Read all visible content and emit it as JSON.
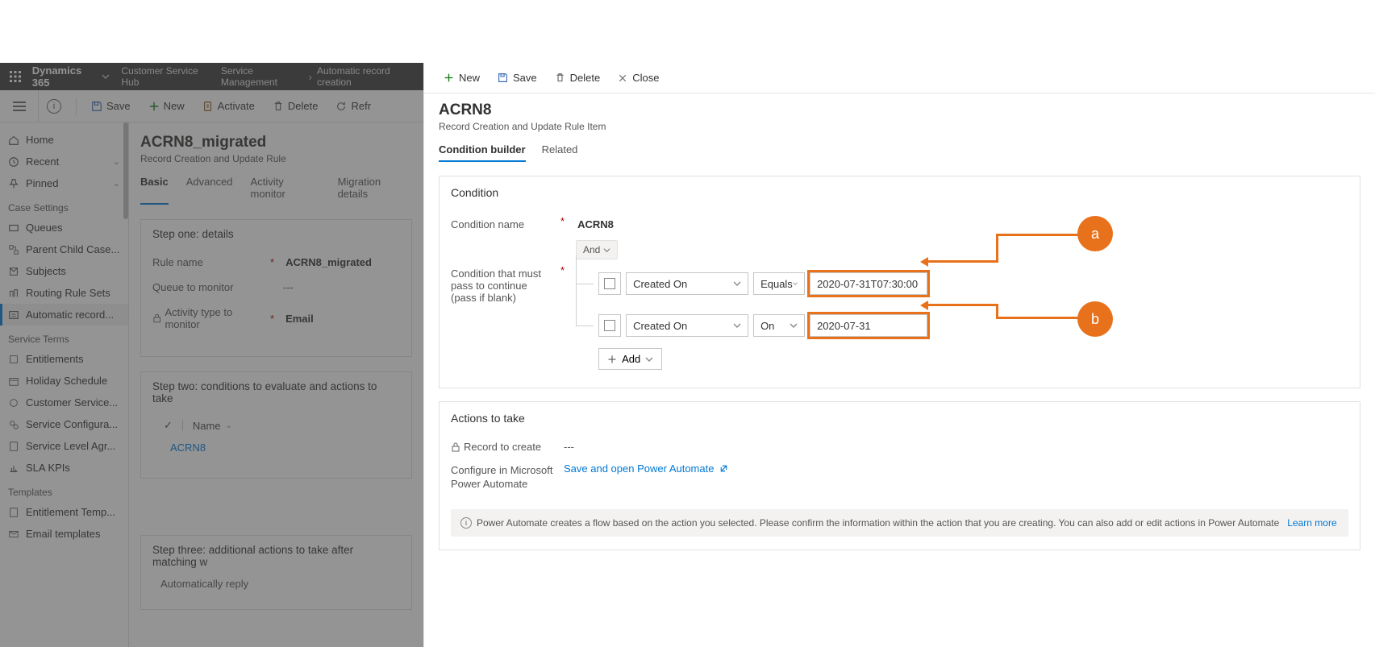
{
  "top_nav": {
    "brand": "Dynamics 365",
    "app_name": "Customer Service Hub",
    "breadcrumb": [
      "Service Management",
      "Automatic record creation"
    ]
  },
  "back_cmd": {
    "save": "Save",
    "new": "New",
    "activate": "Activate",
    "delete": "Delete",
    "refresh": "Refr"
  },
  "sidebar": {
    "home": "Home",
    "recent": "Recent",
    "pinned": "Pinned",
    "group_case": "Case Settings",
    "queues": "Queues",
    "parent_child": "Parent Child Case...",
    "subjects": "Subjects",
    "routing": "Routing Rule Sets",
    "automatic": "Automatic record...",
    "group_service": "Service Terms",
    "entitlements": "Entitlements",
    "holiday": "Holiday Schedule",
    "customer_service": "Customer Service...",
    "service_config": "Service Configura...",
    "sla_agr": "Service Level Agr...",
    "sla_kpis": "SLA KPIs",
    "group_templates": "Templates",
    "entitlement_temp": "Entitlement Temp...",
    "email_templates": "Email templates"
  },
  "back_record": {
    "title": "ACRN8_migrated",
    "subtitle": "Record Creation and Update Rule",
    "tabs": [
      "Basic",
      "Advanced",
      "Activity monitor",
      "Migration details"
    ],
    "step1_title": "Step one: details",
    "rule_name_label": "Rule name",
    "rule_name_value": "ACRN8_migrated",
    "queue_label": "Queue to monitor",
    "queue_value": "---",
    "activity_type_label": "Activity type to monitor",
    "activity_type_value": "Email",
    "step2_title": "Step two: conditions to evaluate and actions to take",
    "col_name": "Name",
    "list_item": "ACRN8",
    "step3_title": "Step three: additional actions to take after matching w",
    "auto_reply": "Automatically reply"
  },
  "panel_cmd": {
    "new": "New",
    "save": "Save",
    "delete": "Delete",
    "close": "Close"
  },
  "panel": {
    "title": "ACRN8",
    "subtitle": "Record Creation and Update Rule Item",
    "tabs": [
      "Condition builder",
      "Related"
    ],
    "section_condition": "Condition",
    "cond_name_label": "Condition name",
    "cond_name_value": "ACRN8",
    "cond_pass_label": "Condition that must pass to continue (pass if blank)",
    "and_label": "And",
    "row1_field": "Created On",
    "row1_op": "Equals",
    "row1_val": "2020-07-31T07:30:00",
    "row2_field": "Created On",
    "row2_op": "On",
    "row2_val": "2020-07-31",
    "add_label": "Add",
    "section_actions": "Actions to take",
    "record_create_label": "Record to create",
    "record_create_value": "---",
    "configure_label": "Configure in Microsoft Power Automate",
    "configure_link": "Save and open Power Automate",
    "info_text": "Power Automate creates a flow based on the action you selected. Please confirm the information within the action that you are creating. You can also add or edit actions in Power Automate",
    "learn_more": "Learn more"
  },
  "anno": {
    "a": "a",
    "b": "b"
  }
}
